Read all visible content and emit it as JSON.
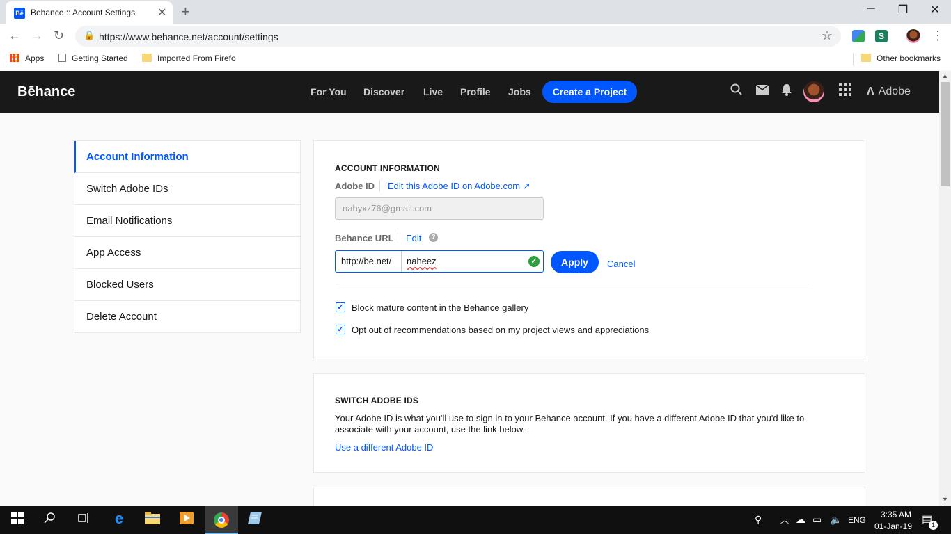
{
  "browser": {
    "tab_title": "Behance :: Account Settings",
    "tab_favicon": "Bē",
    "url": "https://www.behance.net/account/settings",
    "bookmarks": [
      "Apps",
      "Getting Started",
      "Imported From Firefo"
    ],
    "other_bookmarks": "Other bookmarks"
  },
  "header": {
    "logo": "Bēhance",
    "nav": [
      "For You",
      "Discover",
      "Live",
      "Profile",
      "Jobs"
    ],
    "create_button": "Create a Project",
    "adobe": "Adobe"
  },
  "sidebar": {
    "items": [
      {
        "label": "Account Information",
        "active": true
      },
      {
        "label": "Switch Adobe IDs",
        "active": false
      },
      {
        "label": "Email Notifications",
        "active": false
      },
      {
        "label": "App Access",
        "active": false
      },
      {
        "label": "Blocked Users",
        "active": false
      },
      {
        "label": "Delete Account",
        "active": false
      }
    ]
  },
  "account_info": {
    "title": "ACCOUNT INFORMATION",
    "adobe_id_label": "Adobe ID",
    "edit_adobe_link": "Edit this Adobe ID on Adobe.com",
    "email_value": "nahyxz76@gmail.com",
    "behance_url_label": "Behance URL",
    "edit_link": "Edit",
    "url_prefix": "http://be.net/",
    "url_value": "naheez",
    "apply_button": "Apply",
    "cancel_link": "Cancel",
    "checkboxes": [
      {
        "label": "Block mature content in the Behance gallery",
        "checked": true
      },
      {
        "label": "Opt out of recommendations based on my project views and appreciations",
        "checked": true
      }
    ]
  },
  "switch_ids": {
    "title": "SWITCH ADOBE IDS",
    "body": "Your Adobe ID is what you'll use to sign in to your Behance account. If you have a different Adobe ID that you'd like to associate with your account, use the link below.",
    "link": "Use a different Adobe ID"
  },
  "taskbar": {
    "language": "ENG",
    "time": "3:35 AM",
    "date": "01-Jan-19",
    "notification_count": "1"
  },
  "colors": {
    "accent": "#0057ff",
    "header_bg": "#191919",
    "success": "#2e9e3b"
  }
}
